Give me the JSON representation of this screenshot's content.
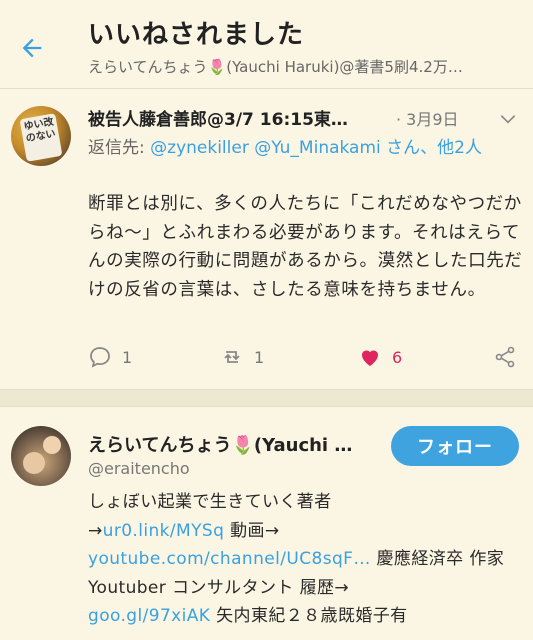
{
  "header": {
    "title": "いいねされました",
    "subtitle": "えらいてんちょう🌷(Yauchi Haruki)@著書5刷4.2万…"
  },
  "tweet": {
    "author": "被告人藤倉善郎@3/7 16:15東…",
    "date": "· 3月9日",
    "reply_prefix": "返信先: ",
    "mentions": "@zynekiller @Yu_Minakami",
    "reply_suffix": " さん、他2人",
    "body": "断罪とは別に、多くの人たちに「これだめなやつだからね〜」とふれまわる必要があります。それはえらてんの実際の行動に問題があるから。漠然とした口先だけの反省の言葉は、さしたる意味を持ちません。",
    "avatar_sign": "ゆい改のない",
    "reply_count": "1",
    "retweet_count": "1",
    "like_count": "6",
    "like_color": "#e0245e"
  },
  "user": {
    "name": "えらいてんちょう🌷(Yauchi …",
    "handle": "@eraitencho",
    "follow_label": "フォロー",
    "bio_1": "しょぼい起業で生きていく著者",
    "bio_2": "→",
    "link_1": "ur0.link/MYSq",
    "bio_3": " 動画→",
    "link_2": "youtube.com/channel/UC8sqF…",
    "bio_4": " 慶應経済卒 作家 Youtuber コンサルタント 履歴→",
    "link_3": "goo.gl/97xiAK",
    "bio_5": " 矢内東紀２８歳既婚子有"
  },
  "colors": {
    "accent": "#3aa0e0",
    "background": "#fbf6e4"
  }
}
